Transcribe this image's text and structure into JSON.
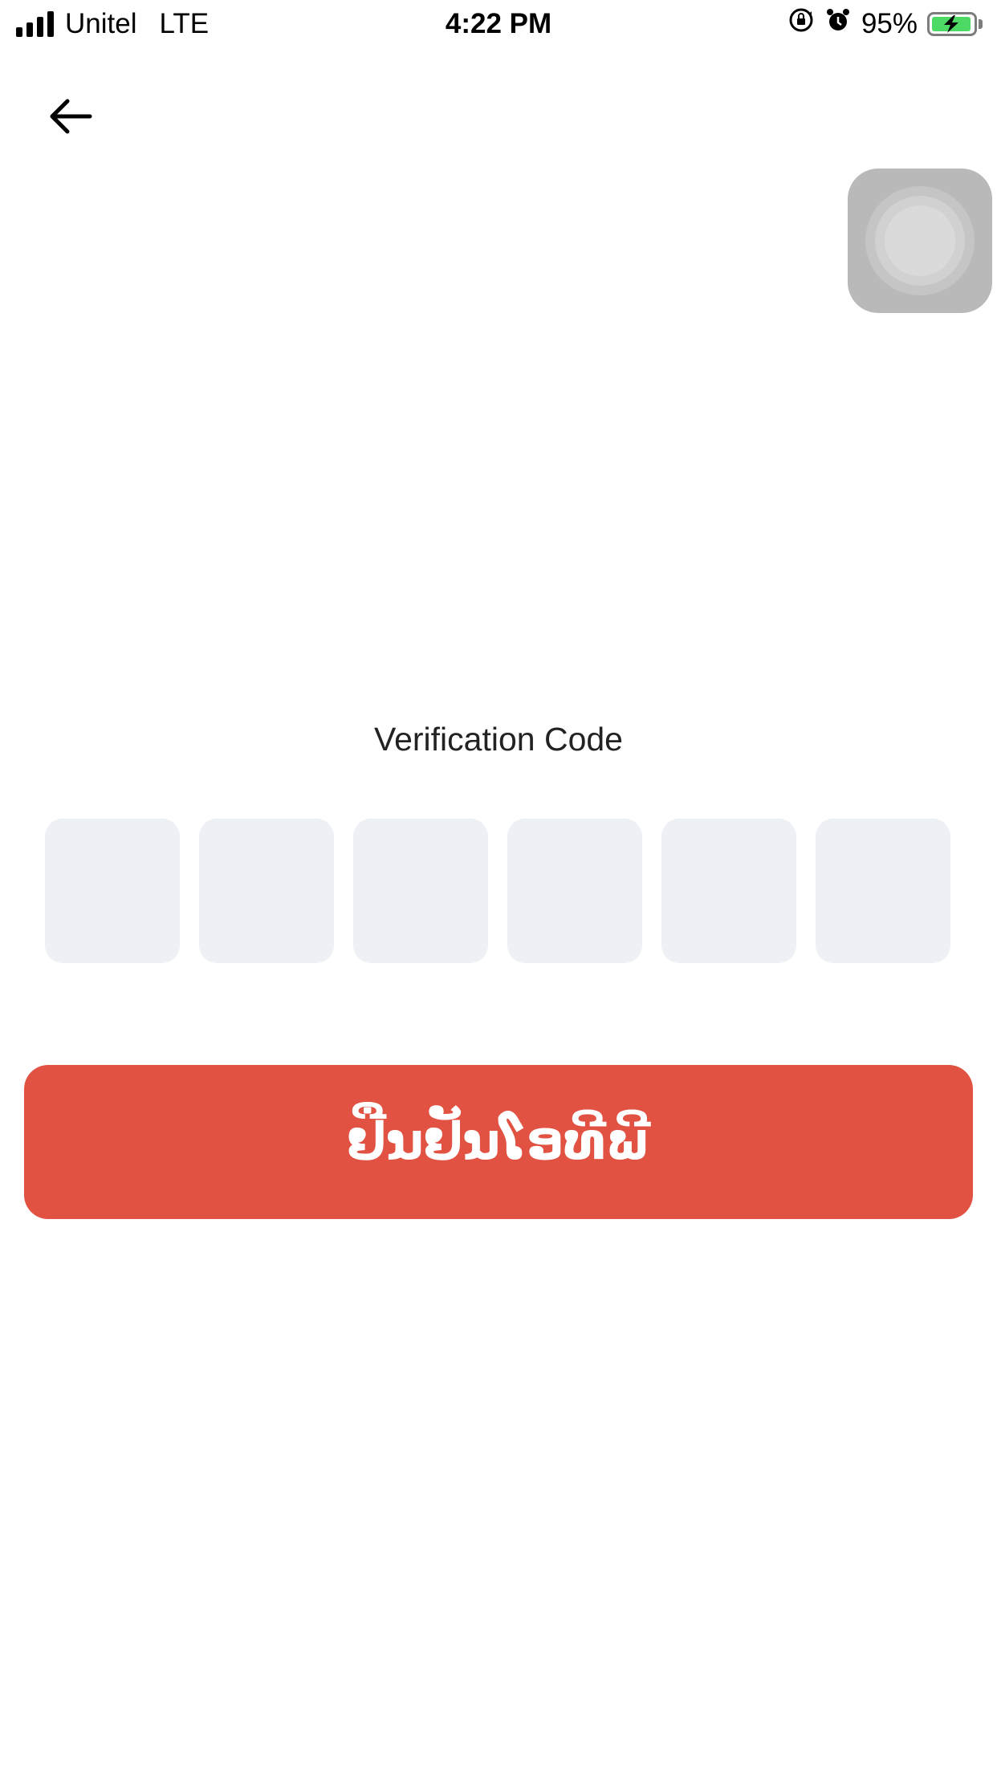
{
  "status_bar": {
    "carrier": "Unitel",
    "network": "LTE",
    "time": "4:22 PM",
    "battery_percent": "95%",
    "battery_level": 0.95,
    "battery_color": "#4cd964",
    "icons": [
      "signal-icon",
      "orientation-lock-icon",
      "alarm-icon",
      "battery-icon"
    ]
  },
  "navigation": {
    "back_icon": "arrow-left-icon"
  },
  "main": {
    "title": "Verification Code",
    "code_boxes": [
      "",
      "",
      "",
      "",
      "",
      ""
    ],
    "confirm_label": "ຢືນຢັນໂອທີພີ"
  },
  "colors": {
    "accent": "#e15242",
    "input_bg": "#edf0f4"
  }
}
